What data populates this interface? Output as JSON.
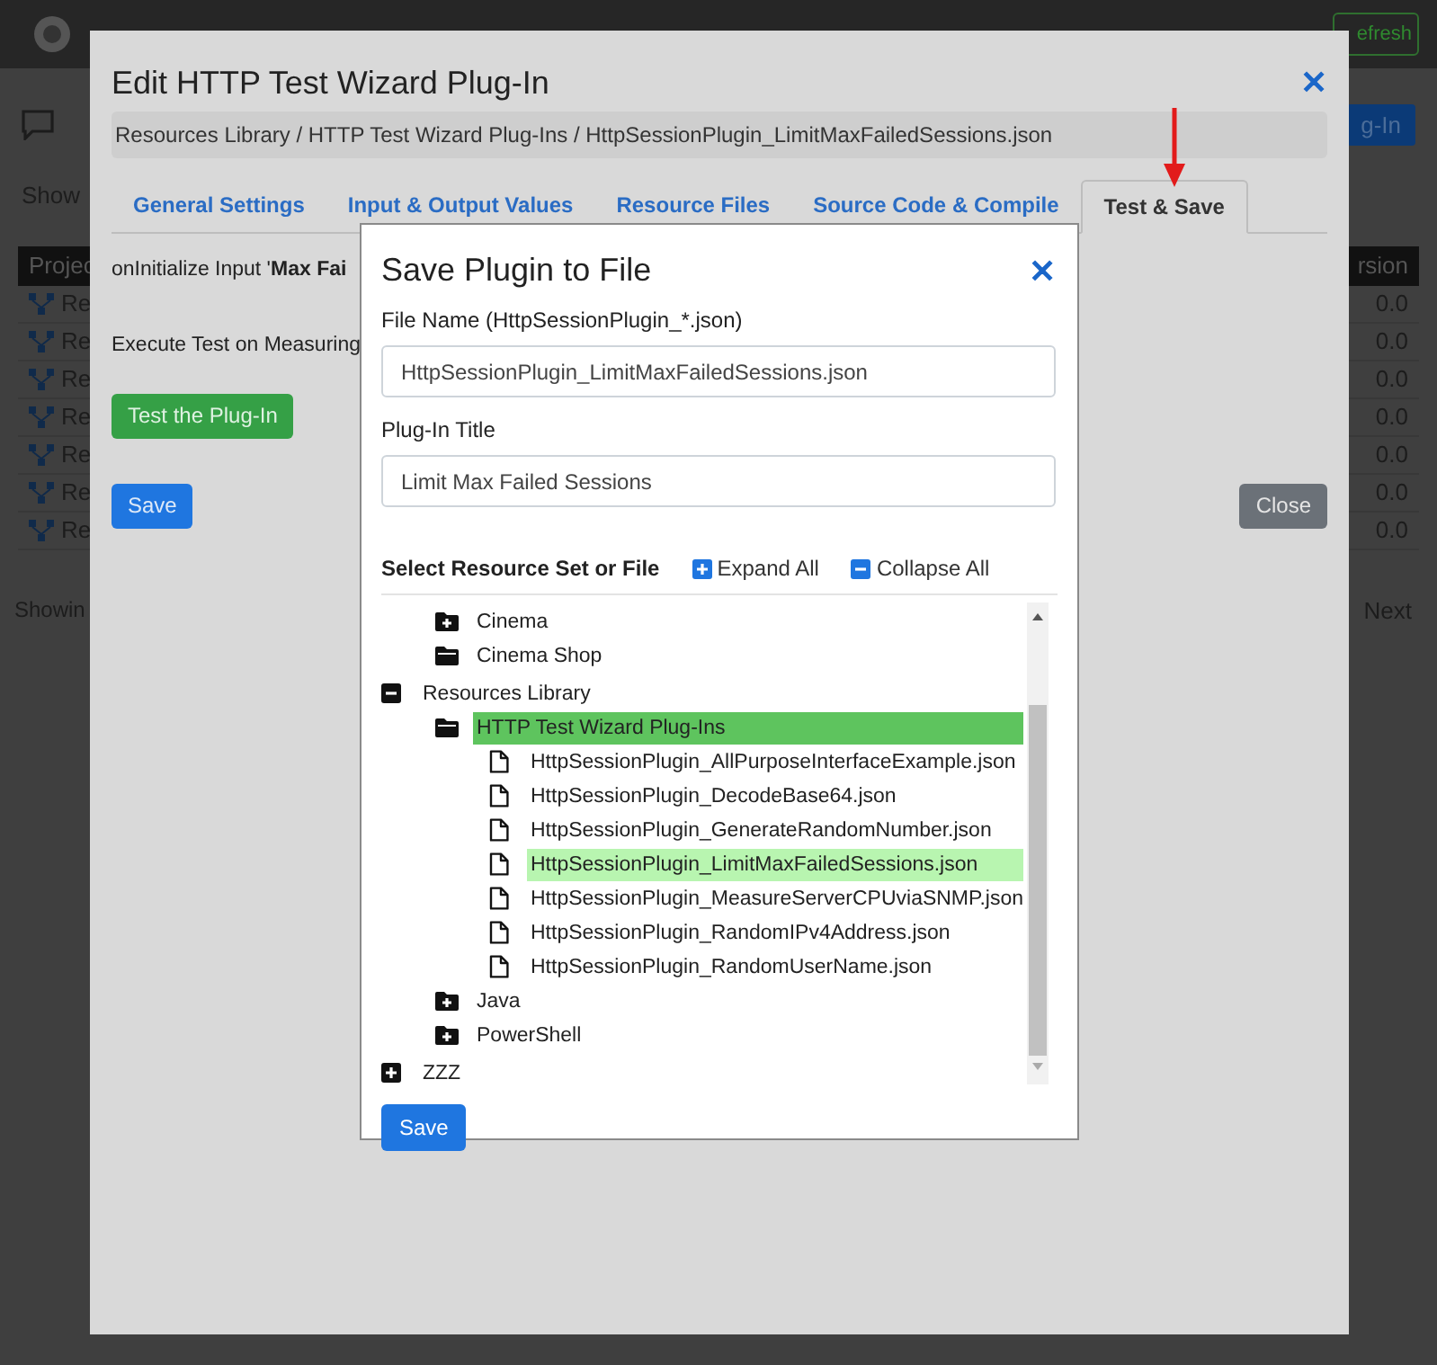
{
  "background": {
    "refresh_button": "efresh",
    "plugin_button": "g-In",
    "show_label": "Show",
    "table": {
      "column_1": "Projec",
      "column_2": "rsion",
      "rows": [
        {
          "column_1": "Re",
          "column_2": "0.0"
        },
        {
          "column_1": "Re",
          "column_2": "0.0"
        },
        {
          "column_1": "Re",
          "column_2": "0.0"
        },
        {
          "column_1": "Re",
          "column_2": "0.0"
        },
        {
          "column_1": "Re",
          "column_2": "0.0"
        },
        {
          "column_1": "Re",
          "column_2": "0.0"
        },
        {
          "column_1": "Re",
          "column_2": "0.0"
        }
      ]
    },
    "footer": "Showin",
    "next_button": "Next"
  },
  "edit_dialog": {
    "title": "Edit HTTP Test Wizard Plug-In",
    "close": "✕",
    "breadcrumb": "Resources Library / HTTP Test Wizard Plug-Ins / HttpSessionPlugin_LimitMaxFailedSessions.json",
    "tabs": [
      {
        "label": "General Settings",
        "selected": false
      },
      {
        "label": "Input & Output Values",
        "selected": false
      },
      {
        "label": "Resource Files",
        "selected": false
      },
      {
        "label": "Source Code & Compile",
        "selected": false
      },
      {
        "label": "Test & Save",
        "selected": true
      }
    ],
    "init_line": "onInitialize Input '**Max Fai**",
    "execute_line": "Execute Test on Measuring",
    "test_button": "Test the Plug-In",
    "save_button": "Save",
    "close_button": "Close"
  },
  "save_dialog": {
    "title": "Save Plugin to File",
    "close": "✕",
    "file_name": {
      "label": "File Name (HttpSessionPlugin_*.json)",
      "value": "HttpSessionPlugin_LimitMaxFailedSessions.json"
    },
    "plugin_title": {
      "label": "Plug-In Title",
      "value": "Limit Max Failed Sessions"
    },
    "tree_heading": "Select Resource Set or File",
    "expand_all": "Expand All",
    "collapse_all": "Collapse All",
    "tree": [
      {
        "kind": "root",
        "children": [
          {
            "kind": "folder",
            "label": "Cinema",
            "expanded": false,
            "selected": false
          },
          {
            "kind": "folder",
            "label": "Cinema Shop",
            "expanded": true,
            "selected": false
          }
        ]
      },
      {
        "kind": "root",
        "label": "Resources Library",
        "expanded": true,
        "children": [
          {
            "kind": "folder",
            "label": "HTTP Test Wizard Plug-Ins",
            "expanded": true,
            "selected": true,
            "children": [
              {
                "kind": "file",
                "label": "HttpSessionPlugin_AllPurposeInterfaceExample.json",
                "selected": false
              },
              {
                "kind": "file",
                "label": "HttpSessionPlugin_DecodeBase64.json",
                "selected": false
              },
              {
                "kind": "file",
                "label": "HttpSessionPlugin_GenerateRandomNumber.json",
                "selected": false
              },
              {
                "kind": "file",
                "label": "HttpSessionPlugin_LimitMaxFailedSessions.json",
                "selected": true
              },
              {
                "kind": "file",
                "label": "HttpSessionPlugin_MeasureServerCPUviaSNMP.json",
                "selected": false
              },
              {
                "kind": "file",
                "label": "HttpSessionPlugin_RandomIPv4Address.json",
                "selected": false
              },
              {
                "kind": "file",
                "label": "HttpSessionPlugin_RandomUserName.json",
                "selected": false
              }
            ]
          },
          {
            "kind": "folder",
            "label": "Java",
            "expanded": false,
            "selected": false
          },
          {
            "kind": "folder",
            "label": "PowerShell",
            "expanded": false,
            "selected": false
          }
        ]
      },
      {
        "kind": "root",
        "label": "ZZZ",
        "expanded": false
      }
    ],
    "save_button": "Save"
  }
}
